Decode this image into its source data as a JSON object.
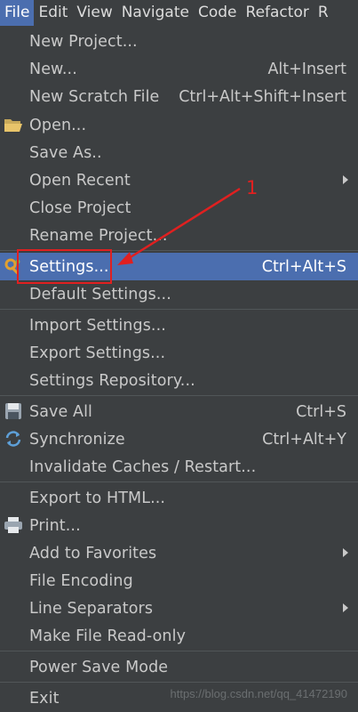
{
  "menubar": {
    "items": [
      "File",
      "Edit",
      "View",
      "Navigate",
      "Code",
      "Refactor",
      "R"
    ]
  },
  "file_menu": {
    "new_project": "New Project...",
    "new": "New...",
    "new_shortcut": "Alt+Insert",
    "new_scratch": "New Scratch File",
    "new_scratch_shortcut": "Ctrl+Alt+Shift+Insert",
    "open": "Open...",
    "save_as": "Save As..",
    "open_recent": "Open Recent",
    "close_project": "Close Project",
    "rename_project": "Rename Project...",
    "settings": "Settings...",
    "settings_shortcut": "Ctrl+Alt+S",
    "default_settings": "Default Settings...",
    "import_settings": "Import Settings...",
    "export_settings": "Export Settings...",
    "settings_repository": "Settings Repository...",
    "save_all": "Save All",
    "save_all_shortcut": "Ctrl+S",
    "synchronize": "Synchronize",
    "synchronize_shortcut": "Ctrl+Alt+Y",
    "invalidate_caches": "Invalidate Caches / Restart...",
    "export_html": "Export to HTML...",
    "print": "Print...",
    "add_favorites": "Add to Favorites",
    "file_encoding": "File Encoding",
    "line_separators": "Line Separators",
    "read_only": "Make File Read-only",
    "power_save": "Power Save Mode",
    "exit": "Exit"
  },
  "annotation": {
    "number": "1",
    "color": "#e02020"
  },
  "watermark": "https://blog.csdn.net/qq_41472190",
  "colors": {
    "background": "#3c3f41",
    "selection": "#4b6eaf",
    "text": "#c9c9c9"
  }
}
